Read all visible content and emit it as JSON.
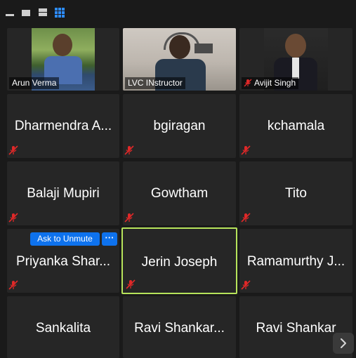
{
  "toolbar": {
    "buttons": [
      {
        "icon": "minimize-icon"
      },
      {
        "icon": "thumbnail-view-icon"
      },
      {
        "icon": "speaker-view-icon"
      },
      {
        "icon": "gallery-view-icon"
      }
    ]
  },
  "tiles": {
    "t0": {
      "name": "Arun Verma"
    },
    "t1": {
      "name": "LVC INstructor"
    },
    "t2": {
      "name": "Avijit Singh"
    },
    "t3": {
      "name": "Dharmendra A..."
    },
    "t4": {
      "name": "bgiragan"
    },
    "t5": {
      "name": "kchamala"
    },
    "t6": {
      "name": "Balaji Mupiri"
    },
    "t7": {
      "name": "Gowtham"
    },
    "t8": {
      "name": "Tito"
    },
    "t9": {
      "name": "Priyanka Shar..."
    },
    "t10": {
      "name": "Jerin Joseph"
    },
    "t11": {
      "name": "Ramamurthy J..."
    },
    "t12": {
      "name": "Sankalita"
    },
    "t13": {
      "name": "Ravi Shankar..."
    },
    "t14": {
      "name": "Ravi Shankar"
    }
  },
  "hover_controls": {
    "ask_to_unmute": "Ask to Unmute",
    "more": "···"
  },
  "colors": {
    "active_speaker_border": "#b7e45b",
    "button_blue": "#0e72ed",
    "muted_red": "#e02828",
    "tile_bg": "#262626"
  }
}
